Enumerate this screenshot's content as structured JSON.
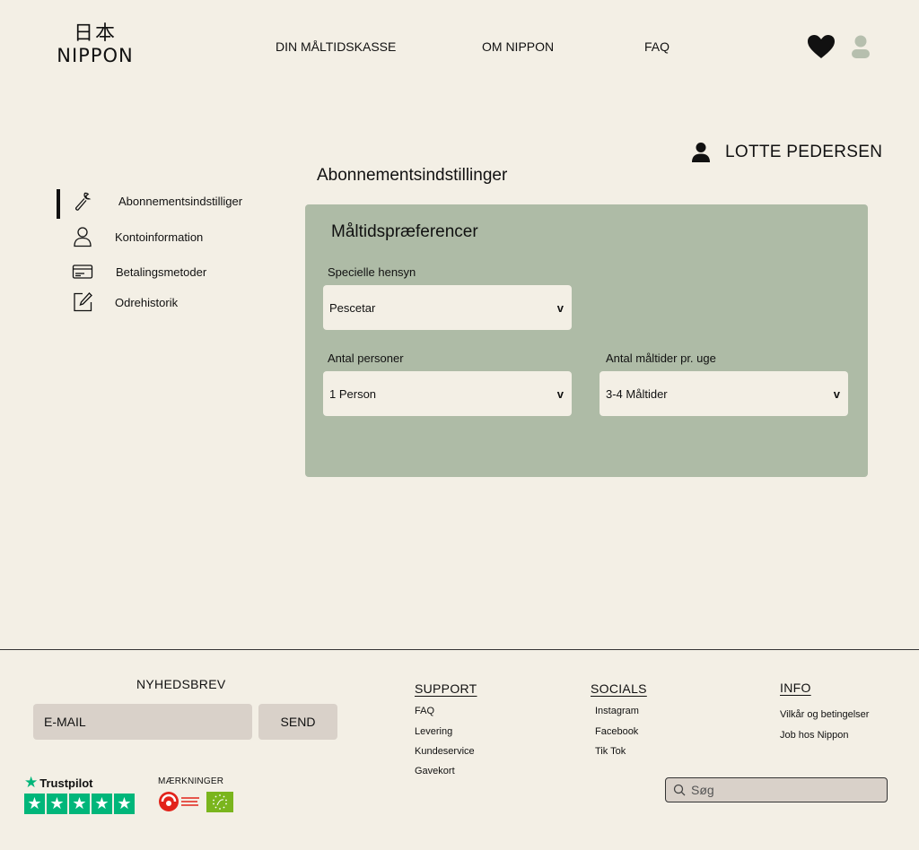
{
  "header": {
    "logo_kanji": "日本",
    "logo_word": "NIPPON",
    "nav": [
      "DIN MÅLTIDSKASSE",
      "OM NIPPON",
      "FAQ"
    ],
    "heart_icon": "heart-icon",
    "user_icon": "user-icon"
  },
  "account": {
    "name": "LOTTE PEDERSEN"
  },
  "page_title": "Abonnementsindstillinger",
  "sidebar": {
    "items": [
      {
        "label": "Abonnementsindstilliger",
        "icon": "wrench-icon",
        "active": true
      },
      {
        "label": "Kontoinformation",
        "icon": "person-outline-icon"
      },
      {
        "label": "Betalingsmetoder",
        "icon": "credit-card-icon"
      },
      {
        "label": "Odrehistorik",
        "icon": "edit-icon"
      }
    ]
  },
  "preferences": {
    "title": "Måltidspræferencer",
    "special": {
      "label": "Specielle hensyn",
      "value": "Pescetar"
    },
    "persons": {
      "label": "Antal personer",
      "value": "1 Person"
    },
    "meals": {
      "label": "Antal måltider pr. uge",
      "value": "3-4 Måltider"
    },
    "chevron": "v"
  },
  "footer": {
    "newsletter": {
      "title": "NYHEDSBREV",
      "email_placeholder": "E-MAIL",
      "send_label": "SEND"
    },
    "support": {
      "title": "SUPPORT",
      "links": [
        "FAQ",
        "Levering",
        "Kundeservice",
        "Gavekort"
      ]
    },
    "socials": {
      "title": "SOCIALS",
      "links": [
        "Instagram",
        "Facebook",
        "Tik Tok"
      ]
    },
    "info": {
      "title": "INFO",
      "links": [
        "Vilkår og betingelser",
        "Job hos Nippon"
      ]
    },
    "trustpilot": "Trustpilot",
    "marks_label": "MÆRKNINGER",
    "search_placeholder": "Søg",
    "colors": {
      "trustpilot_green": "#00b67a",
      "panel": "#aebba6",
      "eu_green": "#7ab51d",
      "red_badge": "#e2231a"
    }
  }
}
